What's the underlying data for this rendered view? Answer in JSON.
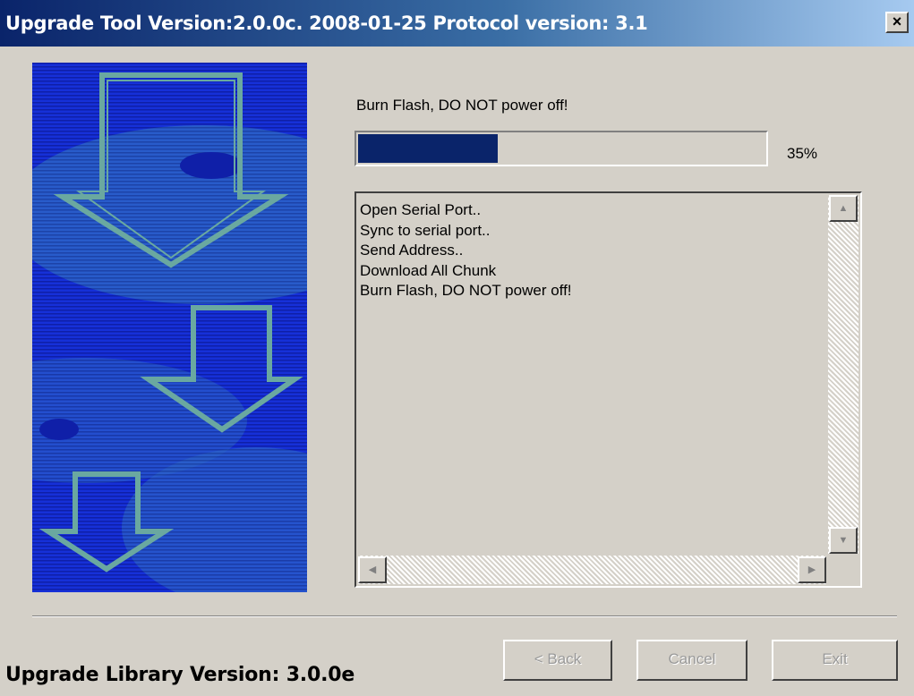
{
  "window": {
    "title": "Upgrade Tool Version:2.0.0c. 2008-01-25 Protocol version: 3.1",
    "close_glyph": "×",
    "close_icon": "close-icon"
  },
  "status": {
    "label": "Burn Flash, DO NOT power off!",
    "progress_percent": 35,
    "progress_text": "35%",
    "progress_color": "#0a246a"
  },
  "log": {
    "lines": [
      "Open Serial Port..",
      "Sync to serial port..",
      "Send Address..",
      "Download All Chunk",
      "Burn Flash, DO NOT power off!"
    ],
    "scroll_up_glyph": "▲",
    "scroll_down_glyph": "▼",
    "scroll_left_glyph": "◀",
    "scroll_right_glyph": "▶"
  },
  "buttons": {
    "back": "< Back",
    "cancel": "Cancel",
    "exit": "Exit"
  },
  "footer": {
    "library_version": "Upgrade Library Version: 3.0.0e"
  },
  "colors": {
    "banner_blue": "#1a2fd0",
    "arrow_teal": "#6aa8a0",
    "dialog_gray": "#d4d0c8"
  }
}
